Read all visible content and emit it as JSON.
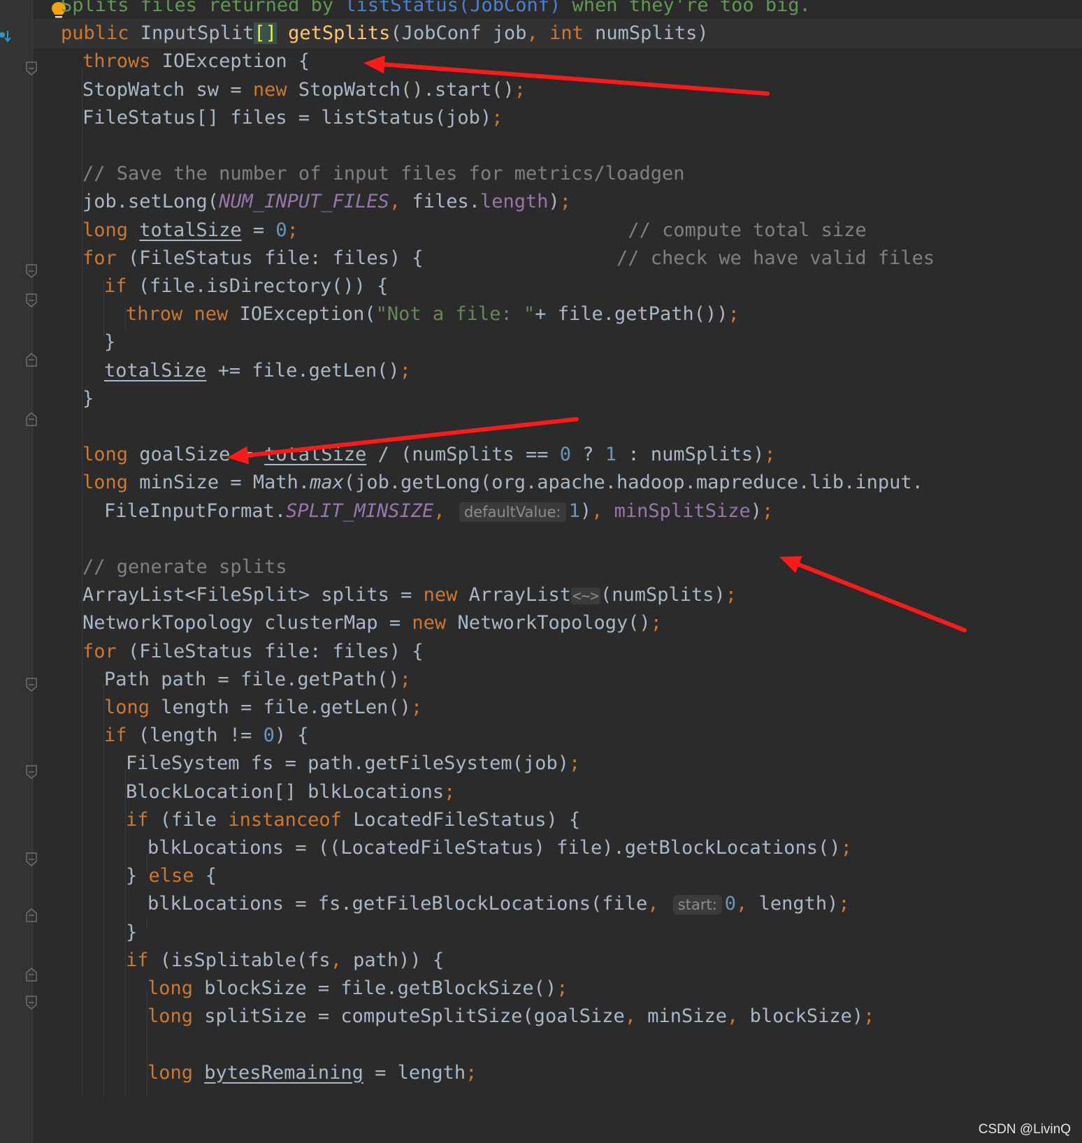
{
  "editor": {
    "accent_colors": {
      "keyword": "#cc7832",
      "method": "#ffc66d",
      "comment": "#808080",
      "string": "#6a8759",
      "number": "#6897bb",
      "field": "#9876aa"
    },
    "lines": [
      {
        "indent": 1,
        "tokens": [
          {
            "t": "Splits files returned by ",
            "c": "doc"
          },
          {
            "t": "listStatus(JobConf)",
            "c": "doccode"
          },
          {
            "t": " when they're too big.",
            "c": "doc"
          }
        ]
      },
      {
        "indent": 1,
        "current": true,
        "tokens": [
          {
            "t": "public ",
            "c": "kw"
          },
          {
            "t": "InputSplit"
          },
          {
            "t": "[]",
            "c": "br"
          },
          {
            "t": " "
          },
          {
            "t": "getSplits",
            "c": "fn"
          },
          {
            "t": "(JobConf job"
          },
          {
            "t": ",",
            "c": "pun"
          },
          {
            "t": " "
          },
          {
            "t": "int ",
            "c": "kw"
          },
          {
            "t": "numSplits)"
          }
        ]
      },
      {
        "indent": 2,
        "tokens": [
          {
            "t": "throws ",
            "c": "kw"
          },
          {
            "t": "IOException {"
          }
        ]
      },
      {
        "indent": 2,
        "tokens": [
          {
            "t": "StopWatch sw = "
          },
          {
            "t": "new ",
            "c": "kw"
          },
          {
            "t": "StopWatch().start()"
          },
          {
            "t": ";",
            "c": "pun"
          }
        ]
      },
      {
        "indent": 2,
        "tokens": [
          {
            "t": "FileStatus[] files = listStatus(job)"
          },
          {
            "t": ";",
            "c": "pun"
          }
        ]
      },
      {
        "indent": 0,
        "tokens": []
      },
      {
        "indent": 2,
        "tokens": [
          {
            "t": "// Save the number of input files for metrics/loadgen",
            "c": "cm"
          }
        ]
      },
      {
        "indent": 2,
        "tokens": [
          {
            "t": "job.setLong("
          },
          {
            "t": "NUM_INPUT_FILES",
            "c": "const"
          },
          {
            "t": ",",
            "c": "pun"
          },
          {
            "t": " files."
          },
          {
            "t": "length",
            "c": "fld"
          },
          {
            "t": ")"
          },
          {
            "t": ";",
            "c": "pun"
          }
        ]
      },
      {
        "indent": 2,
        "tokens": [
          {
            "t": "long ",
            "c": "kw"
          },
          {
            "t": "totalSize",
            "c": "ul"
          },
          {
            "t": " = "
          },
          {
            "t": "0",
            "c": "num"
          },
          {
            "t": ";",
            "c": "pun"
          },
          {
            "t": "                             "
          },
          {
            "t": "// compute total size",
            "c": "cm"
          }
        ]
      },
      {
        "indent": 2,
        "tokens": [
          {
            "t": "for ",
            "c": "kw"
          },
          {
            "t": "(FileStatus file: files) {"
          },
          {
            "t": "                 "
          },
          {
            "t": "// check we have valid files",
            "c": "cm"
          }
        ]
      },
      {
        "indent": 3,
        "tokens": [
          {
            "t": "if ",
            "c": "kw"
          },
          {
            "t": "(file.isDirectory()) {"
          }
        ]
      },
      {
        "indent": 4,
        "tokens": [
          {
            "t": "throw new ",
            "c": "kw"
          },
          {
            "t": "IOException("
          },
          {
            "t": "\"Not a file: \"",
            "c": "str"
          },
          {
            "t": "+ file.getPath())"
          },
          {
            "t": ";",
            "c": "pun"
          }
        ]
      },
      {
        "indent": 3,
        "tokens": [
          {
            "t": "}"
          }
        ]
      },
      {
        "indent": 3,
        "tokens": [
          {
            "t": "totalSize",
            "c": "ul"
          },
          {
            "t": " += file.getLen()"
          },
          {
            "t": ";",
            "c": "pun"
          }
        ]
      },
      {
        "indent": 2,
        "tokens": [
          {
            "t": "}"
          }
        ]
      },
      {
        "indent": 0,
        "tokens": []
      },
      {
        "indent": 2,
        "tokens": [
          {
            "t": "long ",
            "c": "kw"
          },
          {
            "t": "goalSize = "
          },
          {
            "t": "totalSize",
            "c": "ul"
          },
          {
            "t": " / (numSplits == "
          },
          {
            "t": "0",
            "c": "num"
          },
          {
            "t": " ? "
          },
          {
            "t": "1",
            "c": "num"
          },
          {
            "t": " : numSplits)"
          },
          {
            "t": ";",
            "c": "pun"
          }
        ]
      },
      {
        "indent": 2,
        "tokens": [
          {
            "t": "long ",
            "c": "kw"
          },
          {
            "t": "minSize = Math."
          },
          {
            "t": "max",
            "c": "it"
          },
          {
            "t": "(job.getLong(org.apache.hadoop.mapreduce.lib.input."
          }
        ]
      },
      {
        "indent": 3,
        "tokens": [
          {
            "t": "FileInputFormat."
          },
          {
            "t": "SPLIT_MINSIZE",
            "c": "const"
          },
          {
            "t": ",",
            "c": "pun"
          },
          {
            "t": " "
          },
          {
            "t": "defaultValue:",
            "c": "hint"
          },
          {
            "t": "1",
            "c": "num"
          },
          {
            "t": ")"
          },
          {
            "t": ",",
            "c": "pun"
          },
          {
            "t": " "
          },
          {
            "t": "minSplitSize",
            "c": "fld"
          },
          {
            "t": ")"
          },
          {
            "t": ";",
            "c": "pun"
          }
        ]
      },
      {
        "indent": 0,
        "tokens": []
      },
      {
        "indent": 2,
        "tokens": [
          {
            "t": "// generate splits",
            "c": "cm"
          }
        ]
      },
      {
        "indent": 2,
        "tokens": [
          {
            "t": "ArrayList<FileSplit> splits = "
          },
          {
            "t": "new ",
            "c": "kw"
          },
          {
            "t": "ArrayList"
          },
          {
            "t": "<~>",
            "c": "fold"
          },
          {
            "t": "(numSplits)"
          },
          {
            "t": ";",
            "c": "pun"
          }
        ]
      },
      {
        "indent": 2,
        "tokens": [
          {
            "t": "NetworkTopology clusterMap = "
          },
          {
            "t": "new ",
            "c": "kw"
          },
          {
            "t": "NetworkTopology()"
          },
          {
            "t": ";",
            "c": "pun"
          }
        ]
      },
      {
        "indent": 2,
        "tokens": [
          {
            "t": "for ",
            "c": "kw"
          },
          {
            "t": "(FileStatus file: files) {"
          }
        ]
      },
      {
        "indent": 3,
        "tokens": [
          {
            "t": "Path path = file.getPath()"
          },
          {
            "t": ";",
            "c": "pun"
          }
        ]
      },
      {
        "indent": 3,
        "tokens": [
          {
            "t": "long ",
            "c": "kw"
          },
          {
            "t": "length = file.getLen()"
          },
          {
            "t": ";",
            "c": "pun"
          }
        ]
      },
      {
        "indent": 3,
        "tokens": [
          {
            "t": "if ",
            "c": "kw"
          },
          {
            "t": "(length != "
          },
          {
            "t": "0",
            "c": "num"
          },
          {
            "t": ") {"
          }
        ]
      },
      {
        "indent": 4,
        "tokens": [
          {
            "t": "FileSystem fs = path.getFileSystem(job)"
          },
          {
            "t": ";",
            "c": "pun"
          }
        ]
      },
      {
        "indent": 4,
        "tokens": [
          {
            "t": "BlockLocation[] blkLocations"
          },
          {
            "t": ";",
            "c": "pun"
          }
        ]
      },
      {
        "indent": 4,
        "tokens": [
          {
            "t": "if ",
            "c": "kw"
          },
          {
            "t": "(file "
          },
          {
            "t": "instanceof ",
            "c": "kw"
          },
          {
            "t": "LocatedFileStatus) {"
          }
        ]
      },
      {
        "indent": 5,
        "tokens": [
          {
            "t": "blkLocations = ((LocatedFileStatus) file).getBlockLocations()"
          },
          {
            "t": ";",
            "c": "pun"
          }
        ]
      },
      {
        "indent": 4,
        "tokens": [
          {
            "t": "} "
          },
          {
            "t": "else ",
            "c": "kw"
          },
          {
            "t": "{"
          }
        ]
      },
      {
        "indent": 5,
        "tokens": [
          {
            "t": "blkLocations = fs.getFileBlockLocations(file"
          },
          {
            "t": ",",
            "c": "pun"
          },
          {
            "t": " "
          },
          {
            "t": "start:",
            "c": "hint"
          },
          {
            "t": "0",
            "c": "num"
          },
          {
            "t": ",",
            "c": "pun"
          },
          {
            "t": " length)"
          },
          {
            "t": ";",
            "c": "pun"
          }
        ]
      },
      {
        "indent": 4,
        "tokens": [
          {
            "t": "}"
          }
        ]
      },
      {
        "indent": 4,
        "tokens": [
          {
            "t": "if ",
            "c": "kw"
          },
          {
            "t": "(isSplitable(fs"
          },
          {
            "t": ",",
            "c": "pun"
          },
          {
            "t": " path)) {"
          }
        ]
      },
      {
        "indent": 5,
        "tokens": [
          {
            "t": "long ",
            "c": "kw"
          },
          {
            "t": "blockSize = file.getBlockSize()"
          },
          {
            "t": ";",
            "c": "pun"
          }
        ]
      },
      {
        "indent": 5,
        "tokens": [
          {
            "t": "long ",
            "c": "kw"
          },
          {
            "t": "splitSize = computeSplitSize(goalSize"
          },
          {
            "t": ",",
            "c": "pun"
          },
          {
            "t": " minSize"
          },
          {
            "t": ",",
            "c": "pun"
          },
          {
            "t": " blockSize)"
          },
          {
            "t": ";",
            "c": "pun"
          }
        ]
      },
      {
        "indent": 0,
        "tokens": []
      },
      {
        "indent": 5,
        "tokens": [
          {
            "t": "long ",
            "c": "kw"
          },
          {
            "t": "bytesRemaining",
            "c": "ul"
          },
          {
            "t": " = length"
          },
          {
            "t": ";",
            "c": "pun"
          }
        ]
      }
    ]
  },
  "gutter": {
    "icons": [
      "lightbulb-icon",
      "override-method-icon",
      "fold-marker-icon"
    ]
  },
  "annotations": {
    "arrow_color": "#ff1a1a"
  },
  "watermark": {
    "text": "CSDN @LivinQ"
  }
}
